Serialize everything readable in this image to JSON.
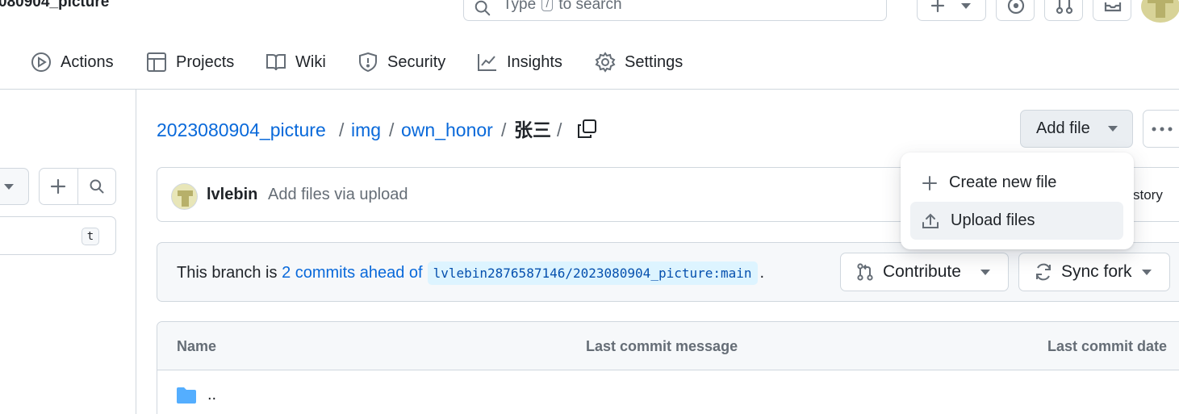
{
  "header": {
    "repo_title": "080904_picture",
    "search": {
      "prefix": "Type",
      "kbd": "/",
      "suffix": "to search"
    }
  },
  "tabs": [
    {
      "label": "Actions",
      "icon": "play-circle-icon"
    },
    {
      "label": "Projects",
      "icon": "table-icon"
    },
    {
      "label": "Wiki",
      "icon": "book-icon"
    },
    {
      "label": "Security",
      "icon": "shield-icon"
    },
    {
      "label": "Insights",
      "icon": "graph-icon"
    },
    {
      "label": "Settings",
      "icon": "gear-icon"
    }
  ],
  "left_pane": {
    "filter_shortcut": "t"
  },
  "breadcrumb": {
    "repo": "2023080904_picture",
    "sep1": "/",
    "dir1": "img",
    "sep2": "/",
    "dir2": "own_honor",
    "sep3": "/",
    "current": "张三",
    "sep4": "/"
  },
  "add_file": {
    "label": "Add file",
    "menu": [
      {
        "label": "Create new file",
        "icon": "plus-icon"
      },
      {
        "label": "Upload files",
        "icon": "upload-icon"
      }
    ]
  },
  "latest_commit": {
    "author": "lvlebin",
    "message": "Add files via upload",
    "history_label": "story"
  },
  "branch_status": {
    "prefix": "This branch is",
    "link": "2 commits ahead of",
    "upstream": "lvlebin2876587146/2023080904_picture:main",
    "suffix": ".",
    "contribute_label": "Contribute",
    "sync_label": "Sync fork"
  },
  "file_table": {
    "columns": [
      "Name",
      "Last commit message",
      "Last commit date"
    ],
    "rows": [
      {
        "name": "..",
        "icon": "folder-icon"
      }
    ]
  },
  "colors": {
    "link": "#0969da",
    "border": "#d0d7de",
    "muted": "#656d76",
    "folder": "#54aeff",
    "menu_hover": "#eff2f5"
  }
}
